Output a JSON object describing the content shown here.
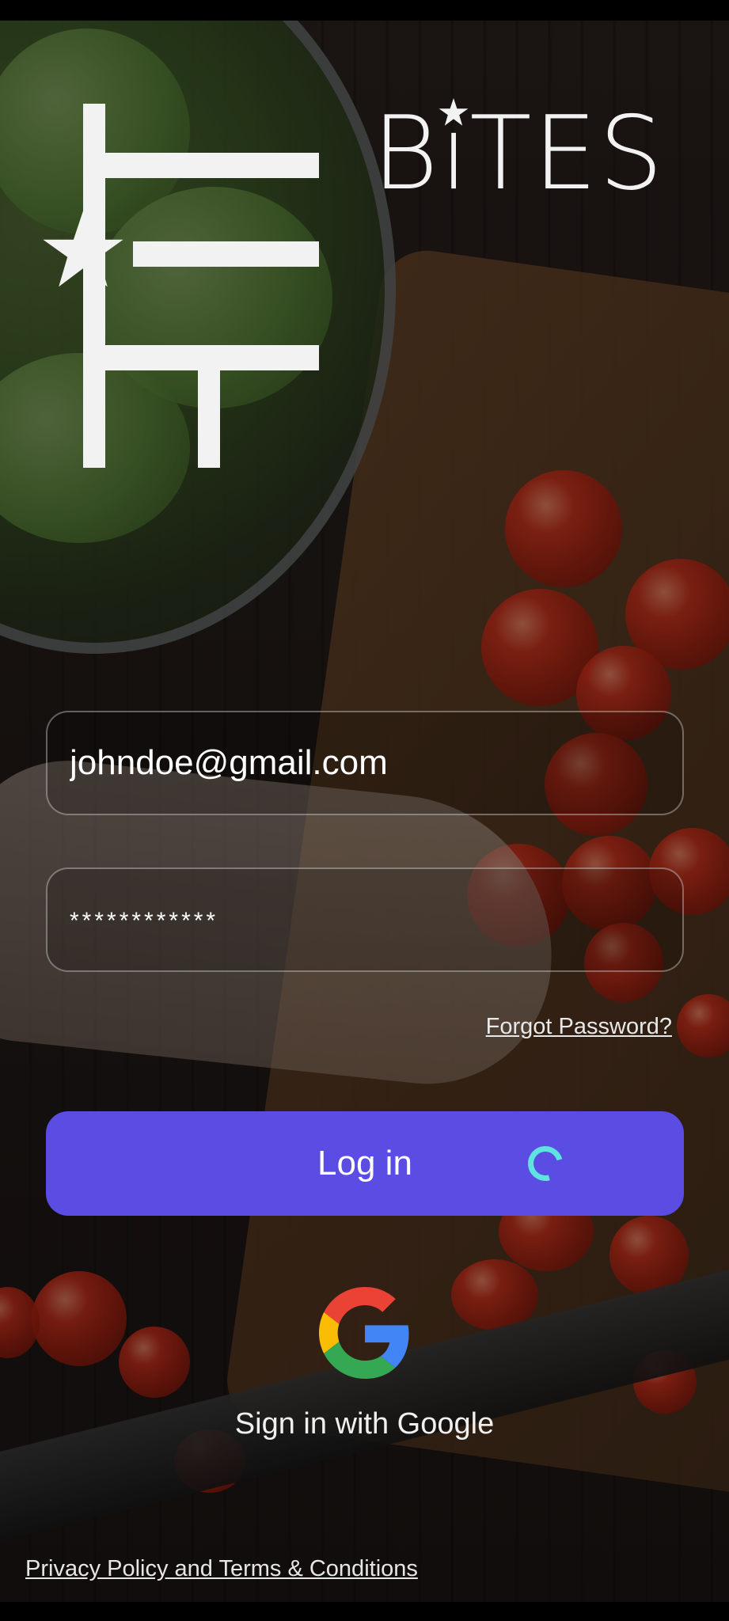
{
  "app": {
    "name": "FIT BITES",
    "logo_word": "BiTES"
  },
  "login": {
    "email_value": "johndoe@gmail.com",
    "password_value": "************",
    "forgot_password": "Forgot Password?",
    "login_button": "Log in",
    "google_signin": "Sign in with Google",
    "privacy": "Privacy Policy and Terms & Conditions"
  },
  "colors": {
    "primary": "#5b4de3",
    "spinner": "#5ee3e0",
    "text": "#ffffff"
  },
  "icons": {
    "spinner": "loading-spinner-icon",
    "google": "google-icon"
  }
}
